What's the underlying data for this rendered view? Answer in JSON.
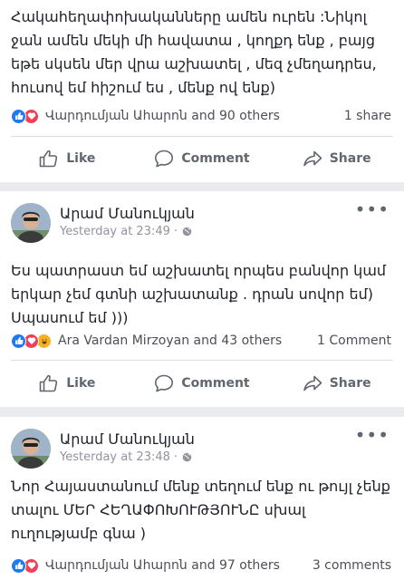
{
  "posts": [
    {
      "text": "Հակահեղափոխականները ամեն ուրեն :Նիկոլ ջան ամեն մեկի մի հավատա , կողքդ ենք , բայց եթե սկսեն մեր վրա աշխատել , մեզ չմեղադրես, հուսով եմ հիշում ես , մենք ով ենք)",
      "reactors": "Վարդումյան Ահարոն and 90 others",
      "right_stat": "1 share"
    },
    {
      "author": "Արամ Մանուկյան",
      "time": "Yesterday at 23:49 ·",
      "text": "Ես պատրաստ եմ աշխատել որպես բանվոր կամ երկար չեմ գտնի աշխատանք . դրան սովոր եմ) Սպասում եմ )))",
      "reactors": "Ara Vardan Mirzoyan and 43 others",
      "right_stat": "1 Comment"
    },
    {
      "author": "Արամ Մանուկյան",
      "time": "Yesterday at 23:48 ·",
      "text": "Նոր Հայաստանում մենք տեղում ենք ու թույլ չենք տալու ՄԵՐ ՀԵՂԱՓՈԽՈՒԹՅՈՒՆԸ սխալ ուղությամբ գնա )",
      "reactors": "Վարդումյան Ահարոն and 97 others",
      "right_stat": "3 comments"
    }
  ],
  "actions": {
    "like": "Like",
    "comment": "Comment",
    "share": "Share"
  },
  "more_label": "•••",
  "colors": {
    "like": "#2078f4",
    "love": "#f33e58",
    "haha": "#f7b125",
    "muted": "#606770",
    "background": "#e9ebee"
  },
  "icons": [
    "like-reaction-icon",
    "love-reaction-icon",
    "haha-reaction-icon",
    "thumbs-up-icon",
    "comment-icon",
    "share-icon",
    "globe-icon",
    "more-icon"
  ]
}
